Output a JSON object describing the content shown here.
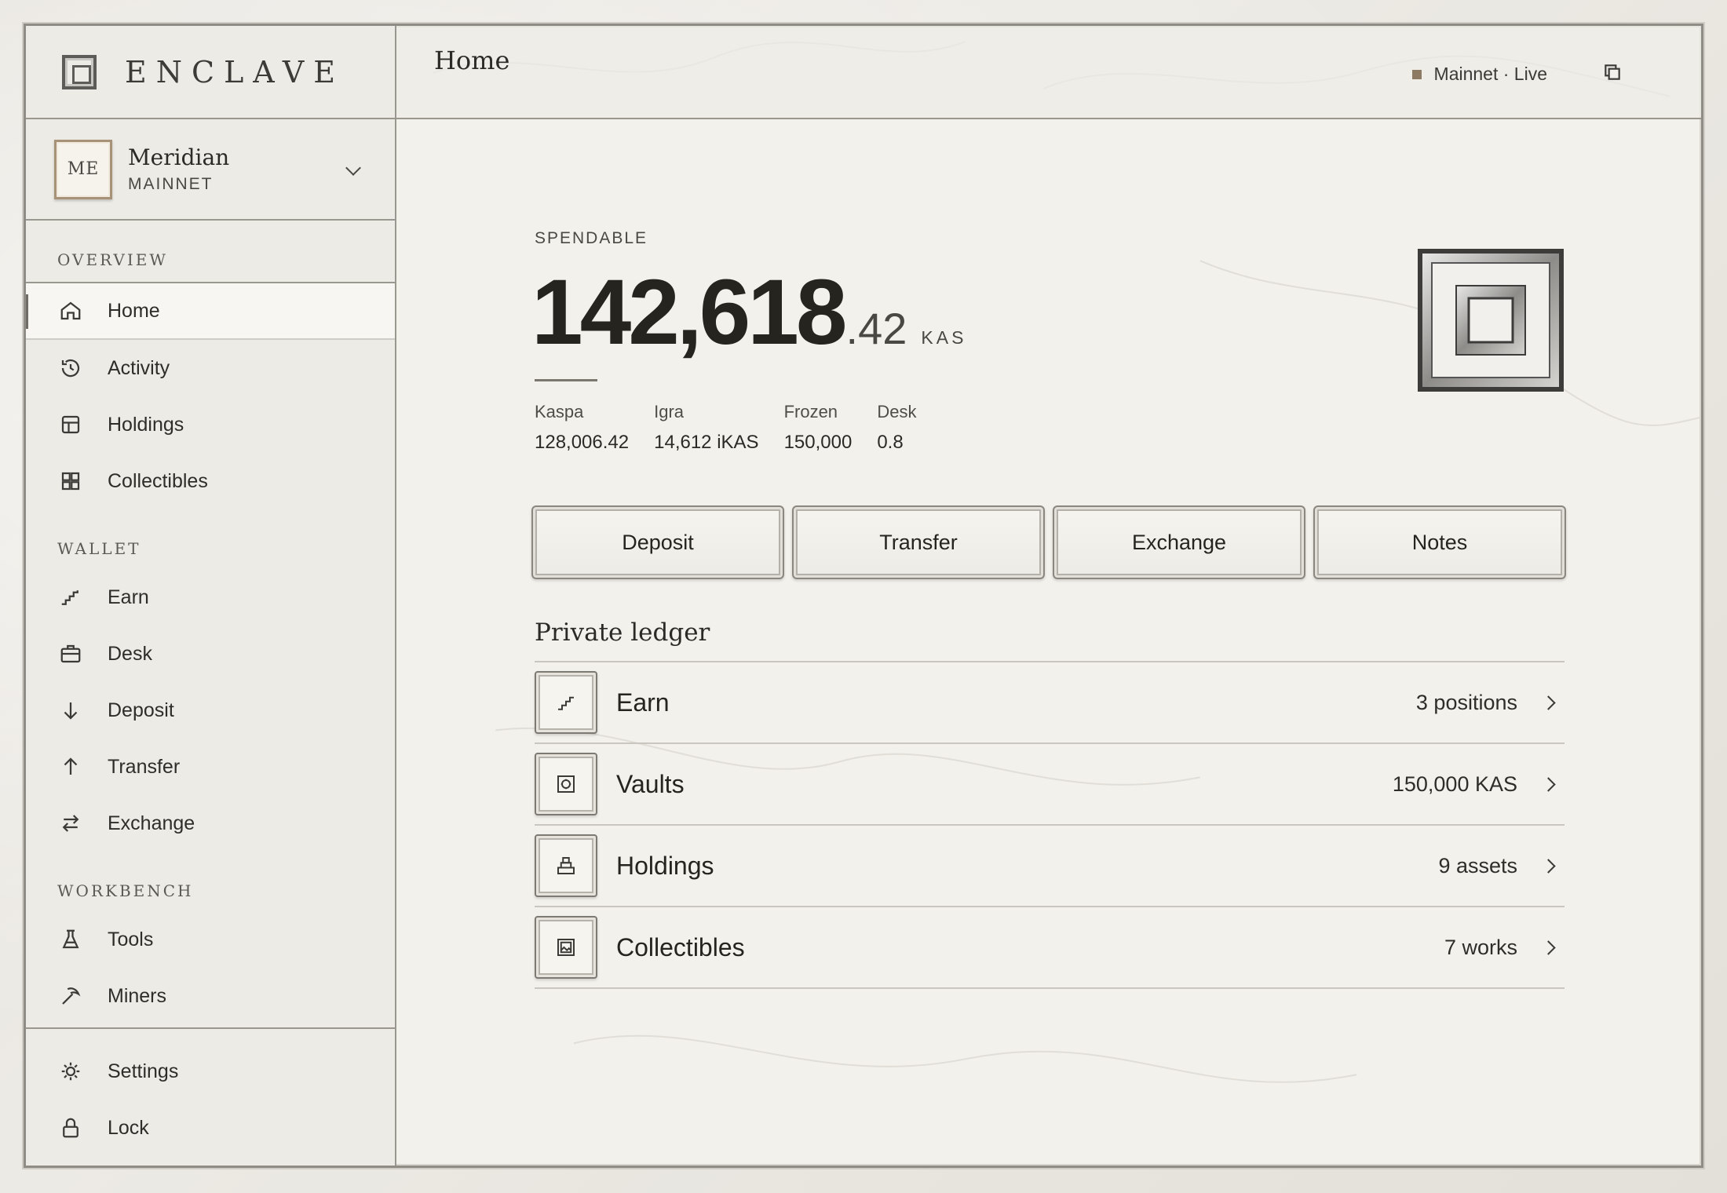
{
  "brand": {
    "name": "ENCLAVE",
    "icon": "vault-square-icon"
  },
  "account": {
    "initials": "ME",
    "name": "Meridian",
    "network": "MAINNET"
  },
  "sidebar": {
    "sections": {
      "overview": "OVERVIEW",
      "wallet": "WALLET",
      "workbench": "WORKBENCH"
    },
    "overview_items": [
      {
        "label": "Home",
        "icon": "home-icon",
        "active": true
      },
      {
        "label": "Activity",
        "icon": "history-icon"
      },
      {
        "label": "Holdings",
        "icon": "layout-icon"
      },
      {
        "label": "Collectibles",
        "icon": "grid-icon"
      }
    ],
    "wallet_items": [
      {
        "label": "Earn",
        "icon": "stairs-icon"
      },
      {
        "label": "Desk",
        "icon": "briefcase-icon"
      },
      {
        "label": "Deposit",
        "icon": "arrow-down-icon"
      },
      {
        "label": "Transfer",
        "icon": "arrow-up-icon"
      },
      {
        "label": "Exchange",
        "icon": "swap-icon"
      }
    ],
    "workbench_items": [
      {
        "label": "Tools",
        "icon": "flask-icon"
      },
      {
        "label": "Miners",
        "icon": "pickaxe-icon"
      }
    ],
    "footer_items": [
      {
        "label": "Settings",
        "icon": "gear-icon"
      },
      {
        "label": "Lock",
        "icon": "lock-icon"
      }
    ]
  },
  "header": {
    "title": "Home",
    "network_status": "Mainnet · Live",
    "status_color": "#8c7a62"
  },
  "balance": {
    "label": "SPENDABLE",
    "integer": "142,618",
    "decimal": ".42",
    "unit": "KAS",
    "breakdown": [
      {
        "label": "Kaspa",
        "value": "128,006.42"
      },
      {
        "label": "Igra",
        "value": "14,612 iKAS"
      },
      {
        "label": "Frozen",
        "value": "150,000"
      },
      {
        "label": "Desk",
        "value": "0.8"
      }
    ]
  },
  "actions": [
    "Deposit",
    "Transfer",
    "Exchange",
    "Notes"
  ],
  "ledger": {
    "title": "Private ledger",
    "rows": [
      {
        "name": "Earn",
        "value": "3 positions",
        "icon": "stairs-icon"
      },
      {
        "name": "Vaults",
        "value": "150,000 KAS",
        "icon": "safe-icon"
      },
      {
        "name": "Holdings",
        "value": "9 assets",
        "icon": "stack-icon"
      },
      {
        "name": "Collectibles",
        "value": "7 works",
        "icon": "picture-icon"
      }
    ]
  }
}
